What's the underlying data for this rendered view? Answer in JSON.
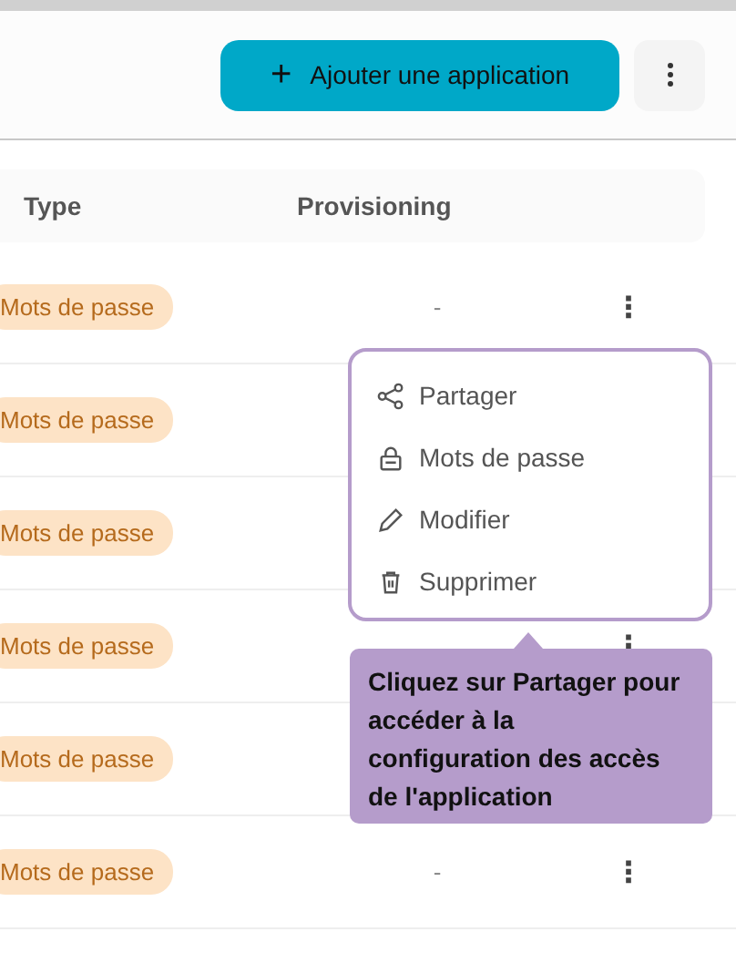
{
  "header": {
    "add_button": {
      "icon": "+",
      "label": "Ajouter une application"
    }
  },
  "table": {
    "columns": [
      "Type",
      "Provisioning"
    ],
    "rows": [
      {
        "type": "Mots de passe",
        "provisioning": "-",
        "actions": "⋮"
      },
      {
        "type": "Mots de passe"
      },
      {
        "type": "Mots de passe"
      },
      {
        "type": "Mots de passe",
        "actions": "⋮"
      },
      {
        "type": "Mots de passe"
      },
      {
        "type": "Mots de passe",
        "provisioning": "-",
        "actions": "⋮"
      }
    ]
  },
  "menu": {
    "items": [
      {
        "kind": "share",
        "label": "Partager"
      },
      {
        "kind": "lock",
        "label": "Mots de passe"
      },
      {
        "kind": "edit",
        "label": "Modifier"
      },
      {
        "kind": "trash",
        "label": "Supprimer"
      }
    ]
  },
  "tooltip": {
    "text": "Cliquez sur Partager pour accéder à la configuration des accès de l'application"
  }
}
